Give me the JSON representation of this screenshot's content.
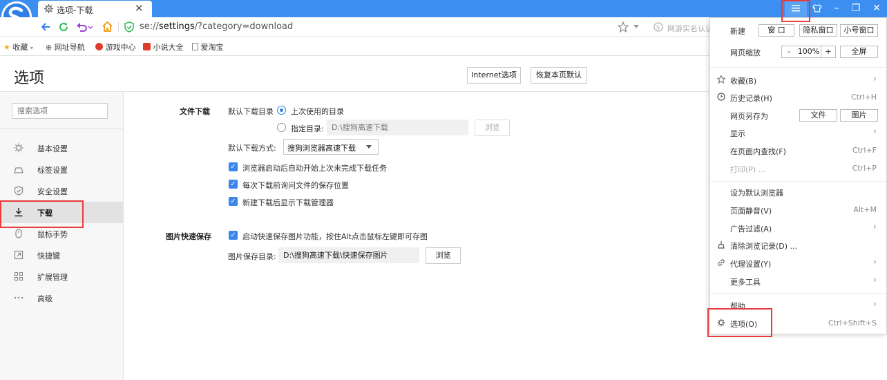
{
  "tab": {
    "title": "选项-下载",
    "close": "✕"
  },
  "window": {
    "minimize": "–",
    "maximize": "❐",
    "close": "✕"
  },
  "address": {
    "url_prefix": "se://",
    "url_bold": "settings",
    "url_rest": "/?category=download",
    "verify_text": "网游实名认证"
  },
  "bookmarks": [
    {
      "label": "收藏",
      "icon": "star-icon"
    },
    {
      "label": "网址导航",
      "icon": "globe-icon"
    },
    {
      "label": "游戏中心",
      "icon": "game-icon"
    },
    {
      "label": "小说大全",
      "icon": "book-icon"
    },
    {
      "label": "爱淘宝",
      "icon": "page-icon"
    }
  ],
  "page": {
    "title": "选项",
    "btn_internet": "Internet选项",
    "btn_restore": "恢复本页默认",
    "search_placeholder": "搜索选项"
  },
  "sidebar": [
    {
      "label": "基本设置",
      "icon": "gear-icon"
    },
    {
      "label": "标签设置",
      "icon": "tab-icon"
    },
    {
      "label": "安全设置",
      "icon": "shield-icon"
    },
    {
      "label": "下载",
      "icon": "download-icon",
      "active": true
    },
    {
      "label": "鼠标手势",
      "icon": "mouse-icon"
    },
    {
      "label": "快捷键",
      "icon": "shortcut-icon"
    },
    {
      "label": "扩展管理",
      "icon": "grid-icon"
    },
    {
      "label": "高级",
      "icon": "dots-icon"
    }
  ],
  "download": {
    "section": "文件下载",
    "dir_label": "默认下载目录",
    "opt_last": "上次使用的目录",
    "opt_specify": "指定目录:",
    "specify_path": "D:\\搜狗高速下载",
    "browse": "浏览",
    "method_label": "默认下载方式:",
    "method_value": "搜狗浏览器高速下载",
    "checks": [
      "浏览器启动后自动开始上次未完成下载任务",
      "每次下载前询问文件的保存位置",
      "新建下载后显示下载管理器"
    ]
  },
  "image": {
    "section": "图片快速保存",
    "check": "启动快速保存图片功能，按住Alt点击鼠标左键即可存图",
    "dir_label": "图片保存目录:",
    "dir_value": "D:\\搜狗高速下载\\快速保存图片",
    "browse": "浏览"
  },
  "menu": {
    "new_label": "新建",
    "new_window": "窗 口",
    "new_private": "隐私窗口",
    "new_small": "小号窗口",
    "zoom_label": "网页缩放",
    "zoom_minus": "-",
    "zoom_value": "100%",
    "zoom_plus": "+",
    "fullscreen": "全屏",
    "favorites": "收藏(B)",
    "history": "历史记录(H)",
    "history_key": "Ctrl+H",
    "saveas": "网页另存为",
    "saveas_file": "文件",
    "saveas_image": "图片",
    "display": "显示",
    "find": "在页面内查找(F)",
    "find_key": "Ctrl+F",
    "print": "打印(P) ...",
    "print_key": "Ctrl+P",
    "default_browser": "设为默认浏览器",
    "mute": "页面静音(V)",
    "mute_key": "Alt+M",
    "adfilter": "广告过滤(A)",
    "clear": "清除浏览记录(D) ...",
    "proxy": "代理设置(Y)",
    "more": "更多工具",
    "help": "帮助",
    "options": "选项(O)",
    "options_key": "Ctrl+Shift+S"
  },
  "colors": {
    "titlebar": "#3c8ff0",
    "accent": "#2f7fe6",
    "highlight": "#e83b3b"
  }
}
